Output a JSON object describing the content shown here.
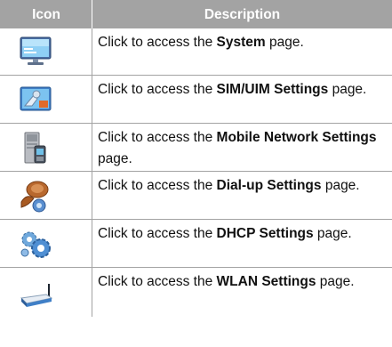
{
  "header": {
    "icon_col": "Icon",
    "desc_col": "Description"
  },
  "rows": [
    {
      "icon": "monitor-icon",
      "pre": "Click to access the ",
      "bold": "System",
      "post": " page."
    },
    {
      "icon": "sim-settings-icon",
      "pre": "Click to access the ",
      "bold": "SIM/UIM Settings",
      "post": " page."
    },
    {
      "icon": "mobile-network-icon",
      "pre": "Click to access the ",
      "bold": "Mobile Network Settings",
      "post": " page."
    },
    {
      "icon": "dialup-settings-icon",
      "pre": "Click to access the ",
      "bold": "Dial-up Settings",
      "post": " page."
    },
    {
      "icon": "dhcp-gears-icon",
      "pre": "Click to access the ",
      "bold": "DHCP Settings",
      "post": " page."
    },
    {
      "icon": "wlan-router-icon",
      "pre": "Click to access the ",
      "bold": "WLAN Settings",
      "post": " page."
    }
  ]
}
